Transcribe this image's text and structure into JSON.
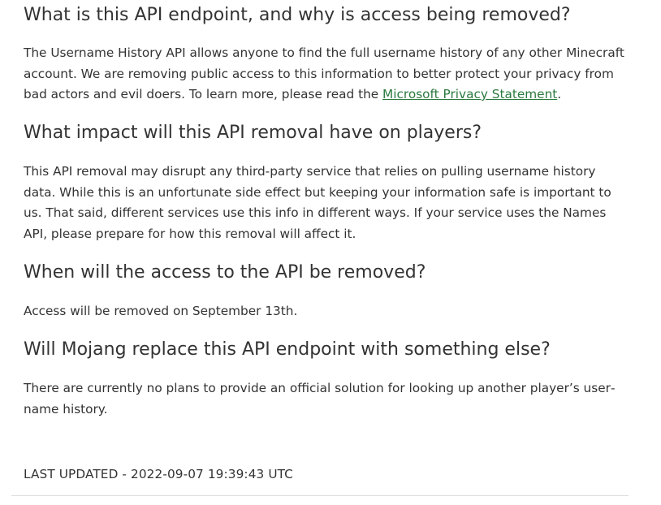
{
  "sections": [
    {
      "heading": "What is this API endpoint, and why is access being removed?",
      "body_before_link": "The Username History API allows anyone to find the full username history of any other Minecraft account. We are removing public access to this information to better protect your privacy from bad actors and evil doers. To learn more, please read the ",
      "link_text": "Microsoft Privacy Statement",
      "body_after_link": "."
    },
    {
      "heading": "What impact will this API removal have on players?",
      "body": "This API removal may disrupt any third-party service that relies on pulling username history data. While this is an unfortunate side effect but keeping your information safe is important to us. That said, different services use this info in different ways. If your service uses the Names API, please prepare for how this removal will affect it."
    },
    {
      "heading": "When will the access to the API be removed?",
      "body": "Access will be removed on September 13th."
    },
    {
      "heading": "Will Mojang replace this API endpoint with something else?",
      "body": "There are currently no plans to provide an official solution for looking up another player’s user­name history."
    }
  ],
  "last_updated": "LAST UPDATED - 2022-09-07 19:39:43 UTC",
  "colors": {
    "text": "#333333",
    "link": "#2c7a3f",
    "divider": "#dddddd"
  }
}
